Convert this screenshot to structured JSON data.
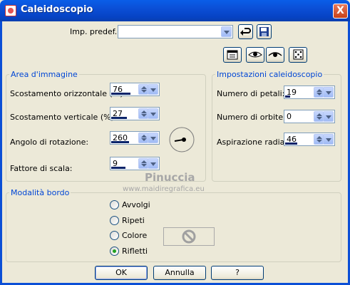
{
  "window": {
    "title": "Caleidoscopio",
    "close_symbol": "X"
  },
  "preset": {
    "label": "Imp. predef.:",
    "value": ""
  },
  "groups": {
    "image_area": "Area d'immagine",
    "kaleido_settings": "Impostazioni caleidoscopio",
    "border_mode": "Modalità bordo"
  },
  "fields": {
    "h_offset": {
      "label": "Scostamento orizzontale (%):",
      "value": "76",
      "level": 0.78
    },
    "v_offset": {
      "label": "Scostamento verticale (%):",
      "value": "27",
      "level": 0.62
    },
    "rotation": {
      "label": "Angolo di rotazione:",
      "value": "260",
      "level": 0.72
    },
    "scale": {
      "label": "Fattore di scala:",
      "value": "9",
      "level": 0.58
    },
    "petals": {
      "label": "Numero di petali:",
      "value": "19",
      "level": 0.18
    },
    "orbits": {
      "label": "Numero di orbite:",
      "value": "0",
      "level": 0
    },
    "radial": {
      "label": "Aspirazione radiale:",
      "value": "46",
      "level": 0.46
    }
  },
  "border_options": [
    {
      "label": "Avvolgi",
      "selected": false
    },
    {
      "label": "Ripeti",
      "selected": false
    },
    {
      "label": "Colore",
      "selected": false
    },
    {
      "label": "Rifletti",
      "selected": true
    }
  ],
  "buttons": {
    "ok": "OK",
    "cancel": "Annulla",
    "help": "?"
  },
  "watermark": {
    "line1": "Pinuccia",
    "line2": "www.maidiregrafica.eu"
  },
  "colors": {
    "accent": "#0046d5",
    "titlebar": "#0b4fd6",
    "slider": "#0a246a"
  }
}
